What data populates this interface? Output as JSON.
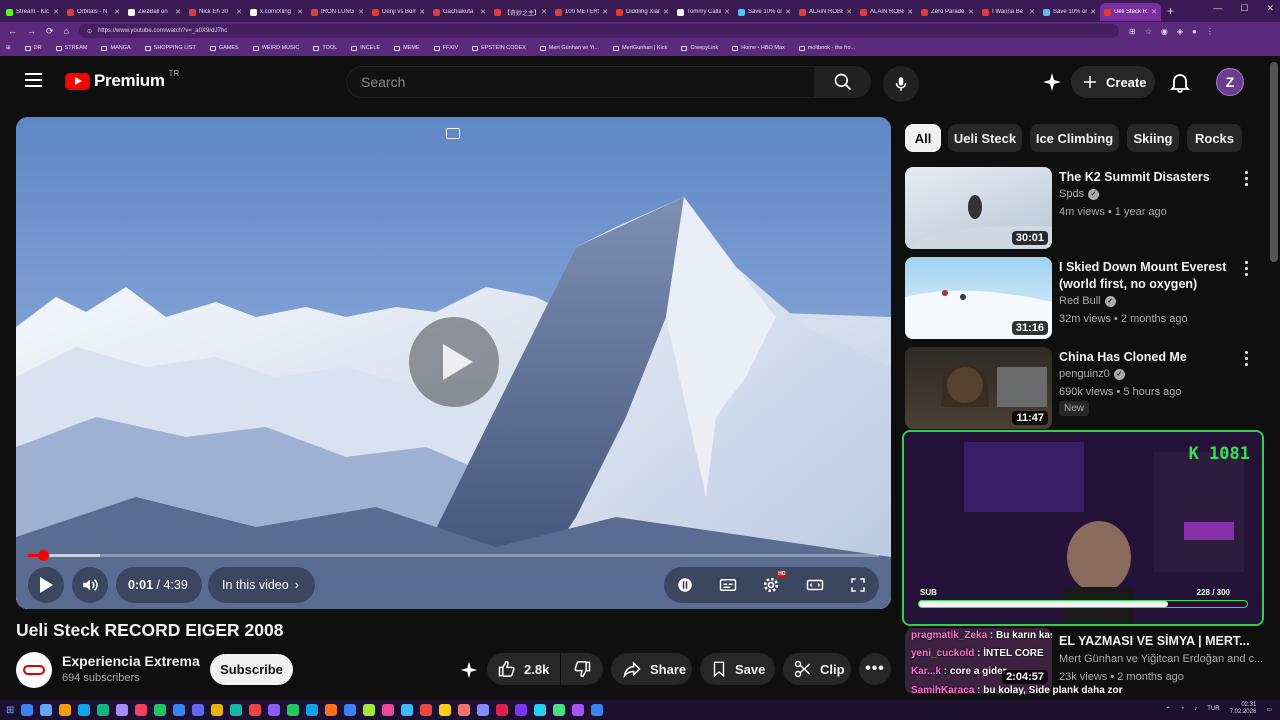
{
  "browser": {
    "tabs": [
      {
        "label": "Stream - Kic",
        "color": "#53fc18"
      },
      {
        "label": "Orbitals - N",
        "color": "#e53935"
      },
      {
        "label": "ZiezBall on",
        "color": "#ffffff"
      },
      {
        "label": "Nick Eh 30",
        "color": "#e53935"
      },
      {
        "label": "x.com/Xling",
        "color": "#ffffff"
      },
      {
        "label": "IRON LUNG",
        "color": "#e53935"
      },
      {
        "label": "Denji vs Bom",
        "color": "#e53935"
      },
      {
        "label": "Gachiakuta",
        "color": "#e53935"
      },
      {
        "label": "【奇妙之主】",
        "color": "#e53935"
      },
      {
        "label": "100 METERS",
        "color": "#e53935"
      },
      {
        "label": "Diddling Xian",
        "color": "#e53935"
      },
      {
        "label": "Tommy Calla",
        "color": "#ffffff"
      },
      {
        "label": "Save 10% on",
        "color": "#4fc3f7"
      },
      {
        "label": "ALAIN ROBER",
        "color": "#e53935"
      },
      {
        "label": "ALAIN ROBER",
        "color": "#e53935"
      },
      {
        "label": "Zero Parade",
        "color": "#e53935"
      },
      {
        "label": "I Wanna Be",
        "color": "#e53935"
      },
      {
        "label": "Save 10% on",
        "color": "#4fc3f7"
      },
      {
        "label": "Ueli Steck R",
        "color": "#e53935",
        "active": true
      }
    ],
    "url": "https://www.youtube.com/watch?v=_a0X9rdJ7hc",
    "bookmarks": [
      "DR",
      "STREAM",
      "MANGA",
      "SHOPPING LIST",
      "GAMES",
      "WEIRD MUSIC",
      "TOOL",
      "INCELE",
      "MEME",
      "FFXIV",
      "EPSTEIN CODEX",
      "Mert Günhan ve Yi...",
      "MertGunhan | Kick",
      "CreepyLink",
      "Home • HBO Max",
      "moltbook - the fro..."
    ]
  },
  "header": {
    "logo_text": "Premium",
    "country_code": "TR",
    "search_placeholder": "Search",
    "create_label": "Create"
  },
  "player": {
    "current_time": "0:01",
    "separator": " / ",
    "duration": "4:39",
    "chapters_label": "In this video",
    "progress_fraction": 0.016,
    "buffered_fraction": 0.085
  },
  "video": {
    "title": "Ueli Steck RECORD EIGER 2008",
    "channel": "Experiencia Extrema",
    "subscribers": "694 subscribers",
    "subscribe_label": "Subscribe",
    "likes": "2.8k",
    "share_label": "Share",
    "save_label": "Save",
    "clip_label": "Clip"
  },
  "chips": [
    "All",
    "Ueli Steck",
    "Ice Climbing",
    "Skiing",
    "Rocks"
  ],
  "recommendations": [
    {
      "title": "The K2 Summit Disasters",
      "channel": "Spds",
      "meta": "4m views • 1 year ago",
      "duration": "30:01",
      "verified": true
    },
    {
      "title": "I Skied Down Mount Everest (world first, no oxygen)",
      "channel": "Red Bull",
      "meta": "32m views • 2 months ago",
      "duration": "31:16",
      "verified": true
    },
    {
      "title": "China Has Cloned Me",
      "channel": "penguinz0",
      "meta": "690k views • 5 hours ago",
      "duration": "11:47",
      "verified": true,
      "badge": "New"
    }
  ],
  "stream_overlay": {
    "follower_count": "K 1081",
    "sub_label": "SUB",
    "goal_text": "228 / 300",
    "goal_fraction": 0.76
  },
  "chat_rec": {
    "title": "EL YAZMASI VE SİMYA | MERT...",
    "channel": "Mert Günhan ve Yiğitcan Erdoğan and c...",
    "meta": "23k views • 2 months ago",
    "duration": "2:04:57",
    "chat_lines": [
      {
        "name": "pragmatik_Zeka",
        "text": " : Bu karın kasları gelistiriyor"
      },
      {
        "name": "yeni_cuckold",
        "text": " : İNTEL CORE"
      },
      {
        "name": "Kar...k",
        "text": " : core a gider.."
      },
      {
        "name": "SamihKaraca",
        "text": " : bu kolay, Side plank daha zor"
      }
    ]
  },
  "taskbar": {
    "lang": "TUR",
    "time": "02:31",
    "date": "7.02.2026",
    "icons": [
      "#3b82f6",
      "#60a5fa",
      "#f59e0b",
      "#0ea5e9",
      "#10b981",
      "#a78bfa",
      "#f43f5e",
      "#22c55e",
      "#3b82f6",
      "#6366f1",
      "#eab308",
      "#14b8a6",
      "#ef4444",
      "#8b5cf6",
      "#22c55e",
      "#0ea5e9",
      "#f97316",
      "#3b82f6",
      "#a3e635",
      "#ec4899",
      "#38bdf8",
      "#ef4444",
      "#facc15",
      "#f87171",
      "#818cf8",
      "#e11d48",
      "#7c3aed",
      "#22d3ee",
      "#4ade80",
      "#a855f7",
      "#3b82f6"
    ]
  }
}
